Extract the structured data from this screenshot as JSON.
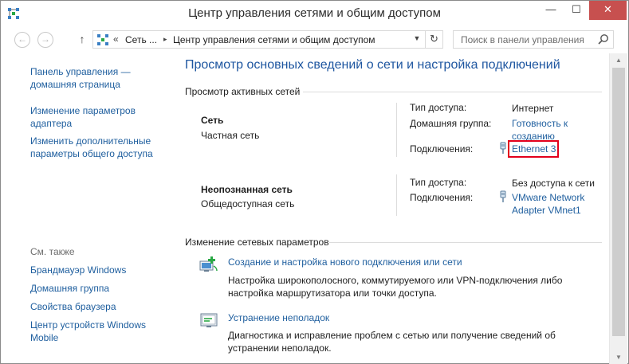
{
  "window": {
    "title": "Центр управления сетями и общим доступом",
    "minimize": "—",
    "maximize": "☐",
    "close": "✕"
  },
  "nav": {
    "back": "←",
    "forward": "→",
    "up": "↑",
    "breadcrumb_sep1": "«",
    "breadcrumb_1": "Сеть ...",
    "breadcrumb_sep2": "▸",
    "breadcrumb_2": "Центр управления сетями и общим доступом",
    "dropdown": "▼",
    "refresh": "↻",
    "search_placeholder": "Поиск в панели управления"
  },
  "sidebar": {
    "home_line1": "Панель управления —",
    "home_line2": "домашняя страница",
    "adapter_line1": "Изменение параметров",
    "adapter_line2": "адаптера",
    "sharing_line1": "Изменить дополнительные",
    "sharing_line2": "параметры общего доступа",
    "see_also": "См. также",
    "firewall": "Брандмауэр Windows",
    "homegroup": "Домашняя группа",
    "browser": "Свойства браузера",
    "device_center_line1": "Центр устройств Windows",
    "device_center_line2": "Mobile"
  },
  "main": {
    "heading": "Просмотр основных сведений о сети и настройка подключений",
    "active_networks_title": "Просмотр активных сетей",
    "networks": [
      {
        "name": "Сеть",
        "type": "Частная сеть",
        "access_label": "Тип доступа:",
        "access_value": "Интернет",
        "homegroup_label": "Домашняя группа:",
        "homegroup_value_line1": "Готовность к",
        "homegroup_value_line2": "созданию",
        "connections_label": "Подключения:",
        "connection_value": "Ethernet 3"
      },
      {
        "name": "Неопознанная сеть",
        "type": "Общедоступная сеть",
        "access_label": "Тип доступа:",
        "access_value": "Без доступа к сети",
        "connections_label": "Подключения:",
        "connection_value_line1": "VMware Network",
        "connection_value_line2": "Adapter VMnet1"
      }
    ],
    "change_settings_title": "Изменение сетевых параметров",
    "tasks": [
      {
        "title": "Создание и настройка нового подключения или сети",
        "desc_line1": "Настройка широкополосного, коммутируемого или VPN-подключения либо",
        "desc_line2": "настройка маршрутизатора или точки доступа."
      },
      {
        "title": "Устранение неполадок",
        "desc_line1": "Диагностика и исправление проблем с сетью или получение сведений об",
        "desc_line2": "устранении неполадок."
      }
    ]
  },
  "scrollbar": {
    "up": "▲",
    "down": "▼"
  },
  "colors": {
    "link": "#1e5e9e",
    "heading": "#1e56a0",
    "close_button": "#c7504f",
    "highlight_box": "#e3001b"
  }
}
